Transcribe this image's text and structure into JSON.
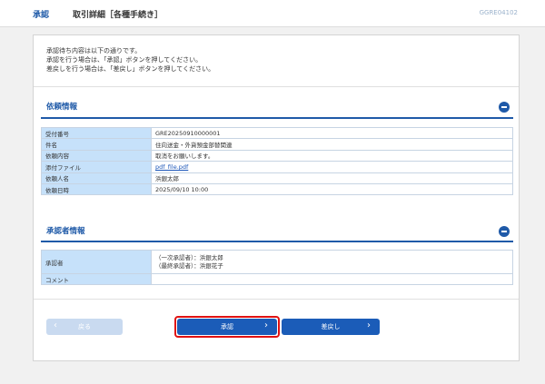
{
  "header": {
    "category": "承認",
    "title": "取引詳細［各種手続き］",
    "screen_code": "GGRE04102"
  },
  "intro": {
    "line1": "承認待ち内容は以下の通りです。",
    "line2": "承認を行う場合は、「承認」ボタンを押してください。",
    "line3": "差戻しを行う場合は、「差戻し」ボタンを押してください。"
  },
  "request_info": {
    "title": "依頼情報",
    "rows": [
      {
        "label": "受付番号",
        "value": "GRE20250910000001"
      },
      {
        "label": "件名",
        "value": "住向送金・外貨預金部替関連"
      },
      {
        "label": "依頼内容",
        "value": "取消をお願いします。"
      },
      {
        "label": "添付ファイル",
        "value": "pdf_file.pdf"
      },
      {
        "label": "依頼人名",
        "value": "浜銀太郎"
      },
      {
        "label": "依頼日時",
        "value": "2025/09/10 10:00"
      }
    ]
  },
  "approver_info": {
    "title": "承認者情報",
    "approver_label": "承認者",
    "approver_line1": "（一次承認者）：浜銀太郎",
    "approver_line2": "（最終承認者）：浜銀花子",
    "comment_label": "コメント",
    "comment_value": ""
  },
  "buttons": {
    "back": "戻る",
    "approve": "承認",
    "return": "差戻し"
  },
  "colors": {
    "accent": "#1f5aa8",
    "label_bg": "#c6e1fa",
    "highlight": "#e01212"
  }
}
